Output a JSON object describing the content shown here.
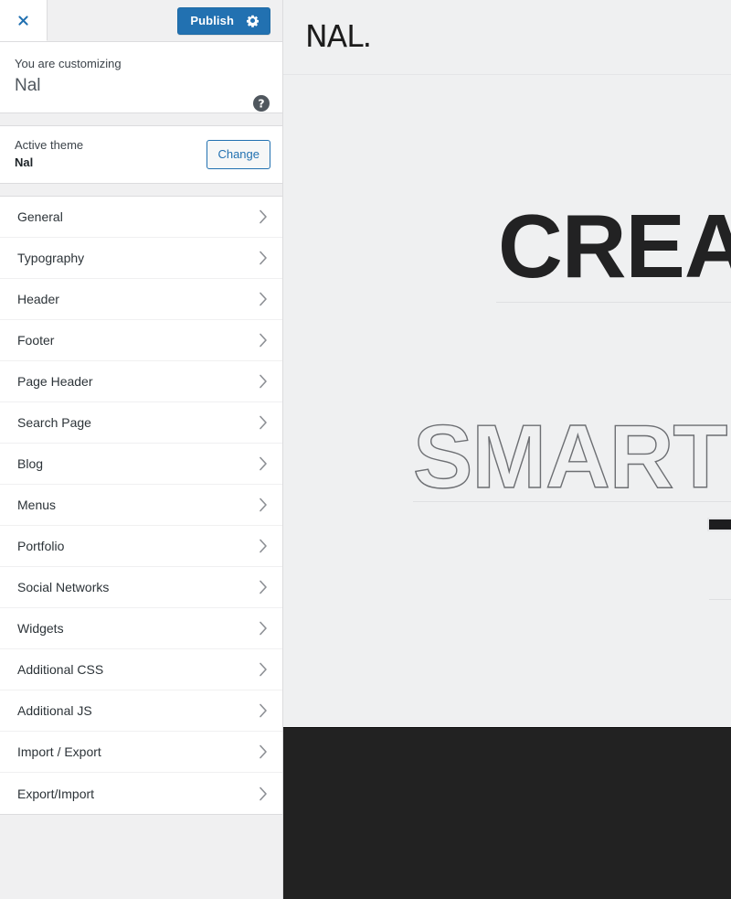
{
  "customizer": {
    "header": {
      "close_icon": "close-icon",
      "publish_label": "Publish",
      "gear_icon": "gear-icon"
    },
    "info": {
      "eyebrow": "You are customizing",
      "site_title": "Nal",
      "help_icon": "help-icon"
    },
    "theme": {
      "label": "Active theme",
      "name": "Nal",
      "change_label": "Change"
    },
    "sections": [
      {
        "label": "General",
        "chevron": "chevron-right-icon"
      },
      {
        "label": "Typography",
        "chevron": "chevron-right-icon"
      },
      {
        "label": "Header",
        "chevron": "chevron-right-icon"
      },
      {
        "label": "Footer",
        "chevron": "chevron-right-icon"
      },
      {
        "label": "Page Header",
        "chevron": "chevron-right-icon"
      },
      {
        "label": "Search Page",
        "chevron": "chevron-right-icon"
      },
      {
        "label": "Blog",
        "chevron": "chevron-right-icon"
      },
      {
        "label": "Menus",
        "chevron": "chevron-right-icon"
      },
      {
        "label": "Portfolio",
        "chevron": "chevron-right-icon"
      },
      {
        "label": "Social Networks",
        "chevron": "chevron-right-icon"
      },
      {
        "label": "Widgets",
        "chevron": "chevron-right-icon"
      },
      {
        "label": "Additional CSS",
        "chevron": "chevron-right-icon"
      },
      {
        "label": "Additional JS",
        "chevron": "chevron-right-icon"
      },
      {
        "label": "Import / Export",
        "chevron": "chevron-right-icon"
      },
      {
        "label": "Export/Import",
        "chevron": "chevron-right-icon"
      }
    ]
  },
  "preview": {
    "logo": "NAL.",
    "hero_line_solid": "CREA",
    "hero_line_outline": "SMART"
  },
  "colors": {
    "accent_blue": "#2271b1",
    "sidebar_bg": "#f0f0f1",
    "panel_white": "#ffffff",
    "border": "#dcdcde",
    "preview_bg": "#eff0f1",
    "hero_text": "#222223",
    "hero_outline": "#6d6f73",
    "dark_section": "#222222"
  }
}
